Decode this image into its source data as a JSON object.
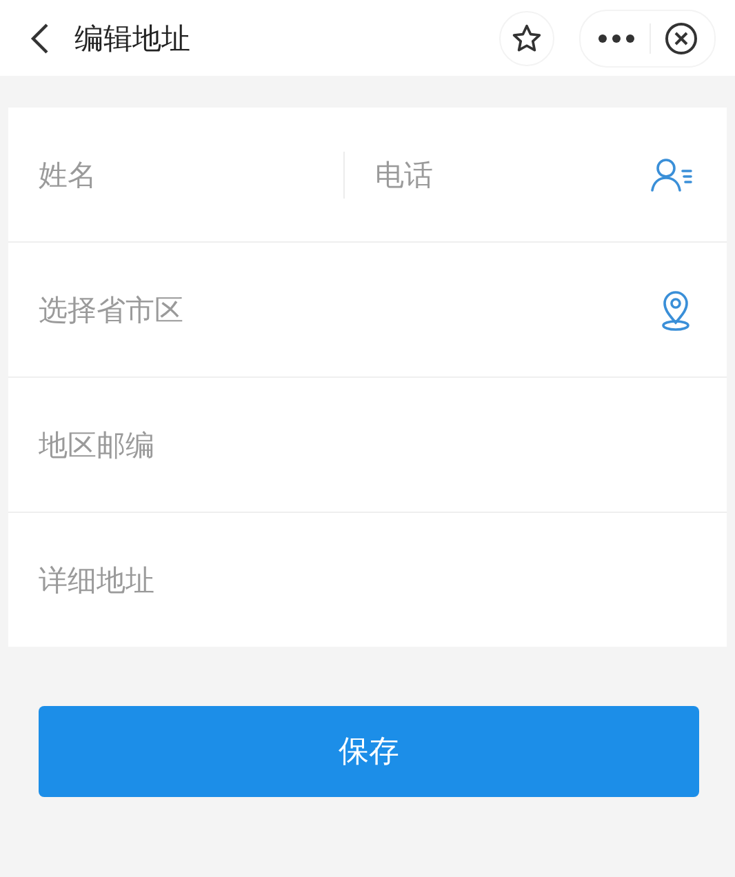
{
  "header": {
    "title": "编辑地址"
  },
  "form": {
    "rows": [
      {
        "kind": "contact",
        "fields": [
          {
            "placeholder": "姓名"
          },
          {
            "placeholder": "电话"
          }
        ]
      },
      {
        "kind": "location",
        "fields": [
          {
            "placeholder": "选择省市区"
          }
        ]
      },
      {
        "kind": "plain",
        "fields": [
          {
            "placeholder": "地区邮编"
          }
        ]
      },
      {
        "kind": "plain",
        "fields": [
          {
            "placeholder": "详细地址"
          }
        ]
      }
    ]
  },
  "save_button": {
    "label": "保存"
  }
}
